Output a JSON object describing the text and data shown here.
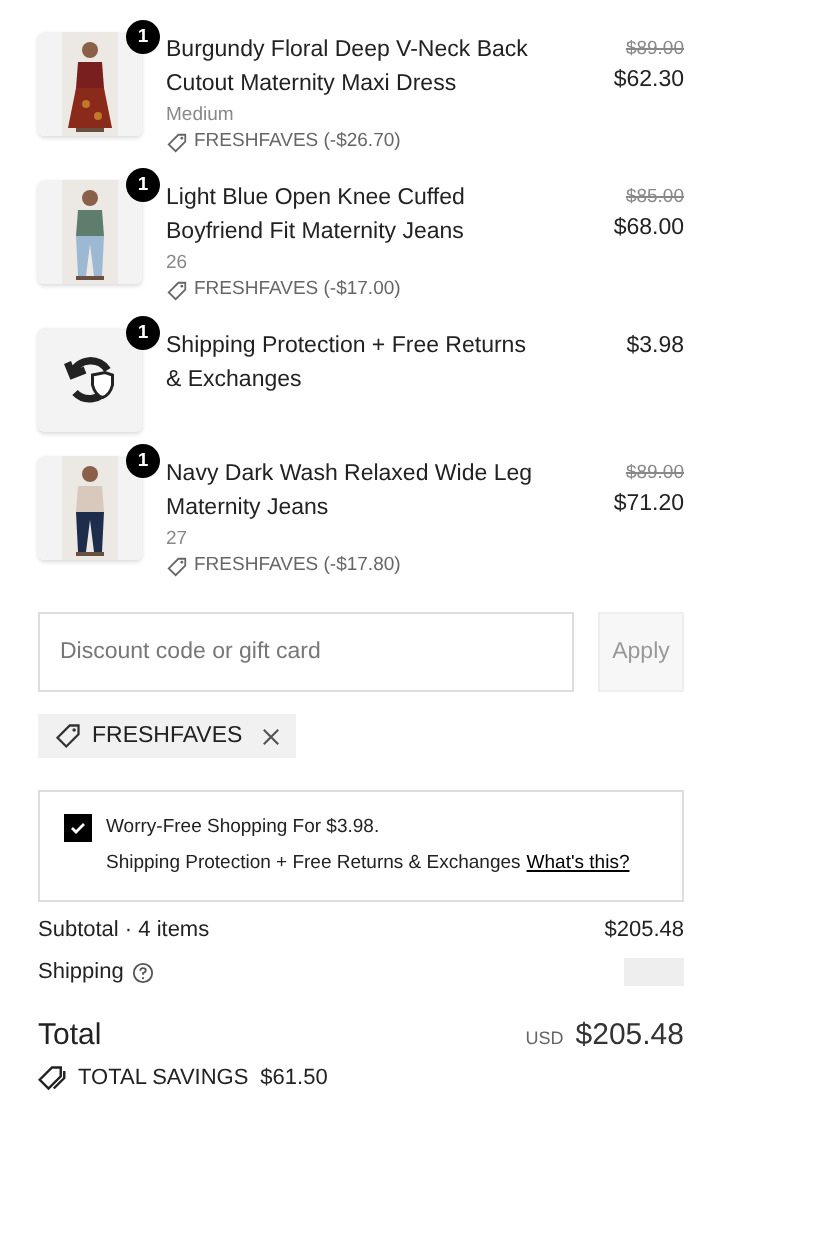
{
  "items": [
    {
      "kind": "product",
      "quantity": "1",
      "name": "Burgundy Floral Deep V-Neck Back Cutout Maternity Maxi Dress",
      "variant": "Medium",
      "discount": "FRESHFAVES (-$26.70)",
      "original_price": "$89.00",
      "price": "$62.30"
    },
    {
      "kind": "product",
      "quantity": "1",
      "name": "Light Blue Open Knee Cuffed Boyfriend Fit Maternity Jeans",
      "variant": "26",
      "discount": "FRESHFAVES (-$17.00)",
      "original_price": "$85.00",
      "price": "$68.00"
    },
    {
      "kind": "protection",
      "quantity": "1",
      "name": "Shipping Protection + Free Returns & Exchanges",
      "price": "$3.98"
    },
    {
      "kind": "product",
      "quantity": "1",
      "name": "Navy Dark Wash Relaxed Wide Leg Maternity Jeans",
      "variant": "27",
      "discount": "FRESHFAVES (-$17.80)",
      "original_price": "$89.00",
      "price": "$71.20"
    }
  ],
  "discount_field": {
    "placeholder": "Discount code or gift card"
  },
  "apply_button": "Apply",
  "applied_code": "FRESHFAVES",
  "protection_box": {
    "checked": true,
    "title": "Worry-Free Shopping For $3.98.",
    "description": "Shipping Protection + Free Returns & Exchanges",
    "link": "What's this?"
  },
  "subtotal": {
    "label": "Subtotal · 4 items",
    "value": "$205.48"
  },
  "shipping": {
    "label": "Shipping"
  },
  "total": {
    "label": "Total",
    "currency": "USD",
    "value": "$205.48"
  },
  "savings": {
    "label": "TOTAL SAVINGS",
    "value": "$61.50"
  }
}
